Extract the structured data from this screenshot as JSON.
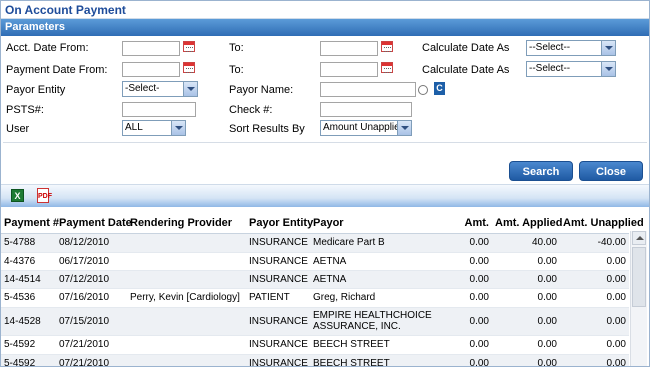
{
  "window": {
    "title": "On Account Payment"
  },
  "params": {
    "header": "Parameters",
    "acct_date_from_label": "Acct. Date From:",
    "payment_date_from_label": "Payment Date From:",
    "payor_entity_label": "Payor Entity",
    "psts_label": "PSTS#:",
    "user_label": "User",
    "to_label": "To:",
    "to2_label": "To:",
    "payor_name_label": "Payor Name:",
    "check_label": "Check #:",
    "sort_label": "Sort Results By",
    "calc_date_label": "Calculate Date As",
    "calc_date2_label": "Calculate Date As",
    "acct_date_from_value": "",
    "acct_date_to_value": "",
    "payment_date_from_value": "",
    "payment_date_to_value": "",
    "payor_name_value": "",
    "psts_value": "",
    "check_value": "",
    "payor_entity_selected": "-Select-",
    "user_selected": "ALL",
    "sort_selected": "Amount Unapplied",
    "calc_date_selected": "--Select--",
    "calc_date2_selected": "--Select--",
    "c_button_label": "C"
  },
  "actions": {
    "search_label": "Search",
    "close_label": "Close"
  },
  "toolbar": {
    "excel_icon": "X",
    "pdf_icon": "PDF"
  },
  "table": {
    "columns": [
      "Payment #",
      "Payment Date",
      "Rendering Provider",
      "Payor Entity",
      "Payor",
      "Amt.",
      "Amt. Applied",
      "Amt. Unapplied"
    ],
    "rows": [
      [
        "5-4788",
        "08/12/2010",
        "",
        "INSURANCE",
        "Medicare Part B",
        "0.00",
        "40.00",
        "-40.00"
      ],
      [
        "4-4376",
        "06/17/2010",
        "",
        "INSURANCE",
        "AETNA",
        "0.00",
        "0.00",
        "0.00"
      ],
      [
        "14-4514",
        "07/12/2010",
        "",
        "INSURANCE",
        "AETNA",
        "0.00",
        "0.00",
        "0.00"
      ],
      [
        "5-4536",
        "07/16/2010",
        "Perry, Kevin [Cardiology]",
        "PATIENT",
        "Greg, Richard",
        "0.00",
        "0.00",
        "0.00"
      ],
      [
        "14-4528",
        "07/15/2010",
        "",
        "INSURANCE",
        "EMPIRE HEALTHCHOICE ASSURANCE, INC.",
        "0.00",
        "0.00",
        "0.00"
      ],
      [
        "5-4592",
        "07/21/2010",
        "",
        "INSURANCE",
        "BEECH STREET",
        "0.00",
        "0.00",
        "0.00"
      ],
      [
        "5-4592",
        "07/21/2010",
        "",
        "INSURANCE",
        "BEECH STREET",
        "0.00",
        "0.00",
        "0.00"
      ]
    ]
  },
  "colors": {
    "accent": "#2f6db5",
    "title": "#1e4c9a",
    "row_alt": "#eef1f5"
  }
}
